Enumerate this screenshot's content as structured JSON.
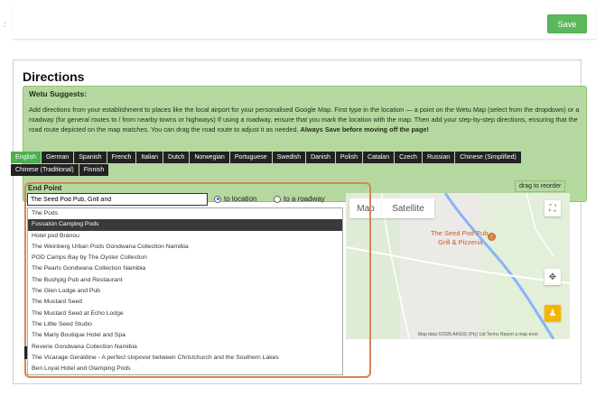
{
  "topbar": {
    "left_text": ":",
    "save_label": "Save"
  },
  "directions": {
    "heading": "Directions",
    "suggest_title": "Wetu Suggests:",
    "suggest_body": "Add directions from your establishment to places like the local airport for your personalised Google Map. First type in the location — a point on the Wetu Map (select from the dropdown) or a roadway (for general routes to / from nearby towns or highways) If using a roadway, ensure that you mark the location with the map. Then add your step-by-step directions, ensuring that the road route depicted on the map matches. You can drag the road route to adjust it as needed.",
    "suggest_bold": "Always Save before moving off the page!"
  },
  "languages": [
    "English",
    "German",
    "Spanish",
    "French",
    "Italian",
    "Dutch",
    "Norwegian",
    "Portuguese",
    "Swedish",
    "Danish",
    "Polish",
    "Catalan",
    "Czech",
    "Russian",
    "Chinese (Simplified)",
    "Chinese (Traditional)",
    "Finnish"
  ],
  "active_language": "English",
  "drag_label": "drag to reorder",
  "endpoint": {
    "label": "End Point",
    "value": "The Seed Pod Pub, Grill and",
    "radio_location": "to location",
    "radio_roadway": "to a roadway"
  },
  "dropdown": [
    "The Pods",
    "Fossatún Camping Pods",
    "Hotel pod Bránou",
    "The Weinberg Urban Pods Gondwana Collection Namibia",
    "POD Camps Bay by The Oyster Collection",
    "The Pearls Gondwana Collection Namibia",
    "The Bushpig Pub and Restaurant",
    "The Glen Lodge and Pub",
    "The Mustard Seed",
    "The Mustard Seed at Echo Lodge",
    "The Little Seed Studio",
    "The Marly Boutique Hotel and Spa",
    "Reverie Gondwana Collection Namibia",
    "The Vicarage Geraldine - A perfect stopover between Christchurch and the Southern Lakes",
    "Ben Loyal Hotel and Glamping Pods"
  ],
  "dropdown_active_index": 1,
  "map": {
    "tab_map": "Map",
    "tab_satellite": "Satellite",
    "place_label_1": "The Seed Pod Pub,",
    "place_label_2": "Grill & Pizzeria",
    "footer": "Map data ©2026 AfriGIS (Pty) Ltd   Terms   Report a map error"
  },
  "colors": {
    "save": "#5cb85c",
    "suggest_bg": "#b5d8a0",
    "active_lang": "#4caf50",
    "highlight": "#d98353"
  }
}
